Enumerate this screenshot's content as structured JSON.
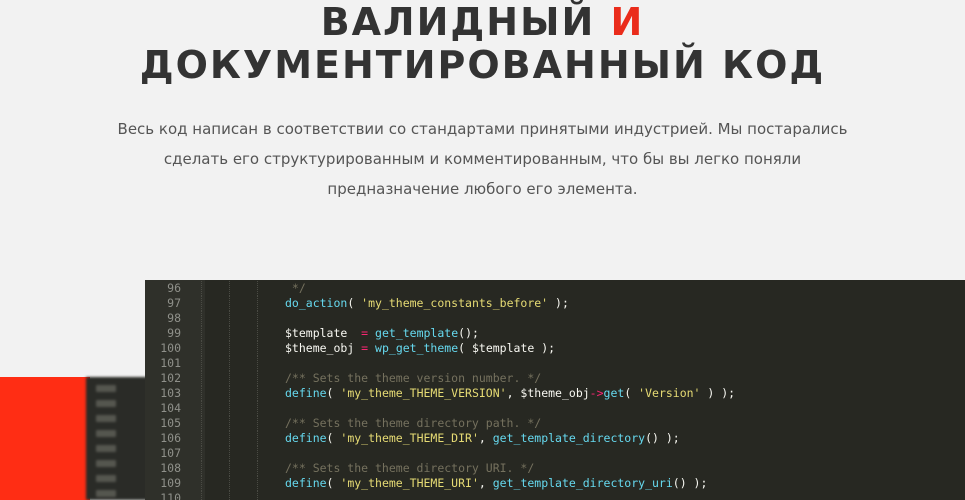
{
  "heading": {
    "line1_main": "ВАЛИДНЫЙ",
    "line1_accent": "И",
    "line2": "ДОКУМЕНТИРОВАННЫЙ КОД"
  },
  "description": {
    "line1": "Весь код написан в соответствии со стандартами принятыми индустрией. Мы постарались",
    "line2": "сделать его структурированным и комментированным, что бы вы легко поняли",
    "line3": "предназначение любого его элемента."
  },
  "colors": {
    "accent": "#ea2c1b",
    "editor_bg": "#272822",
    "red_block": "#ff2d14"
  },
  "code": {
    "lines": [
      {
        "n": "96",
        "tokens": [
          {
            "t": " */",
            "c": "cm"
          }
        ]
      },
      {
        "n": "97",
        "tokens": [
          {
            "t": "do_action",
            "c": "fn"
          },
          {
            "t": "( ",
            "c": ""
          },
          {
            "t": "'my_theme_constants_before'",
            "c": "str"
          },
          {
            "t": " );",
            "c": ""
          }
        ]
      },
      {
        "n": "98",
        "tokens": []
      },
      {
        "n": "99",
        "tokens": [
          {
            "t": "$template  ",
            "c": ""
          },
          {
            "t": "=",
            "c": "op"
          },
          {
            "t": " ",
            "c": ""
          },
          {
            "t": "get_template",
            "c": "fn"
          },
          {
            "t": "();",
            "c": ""
          }
        ]
      },
      {
        "n": "100",
        "tokens": [
          {
            "t": "$theme_obj ",
            "c": ""
          },
          {
            "t": "=",
            "c": "op"
          },
          {
            "t": " ",
            "c": ""
          },
          {
            "t": "wp_get_theme",
            "c": "fn"
          },
          {
            "t": "( $template );",
            "c": ""
          }
        ]
      },
      {
        "n": "101",
        "tokens": []
      },
      {
        "n": "102",
        "tokens": [
          {
            "t": "/** Sets the theme version number. */",
            "c": "cm"
          }
        ]
      },
      {
        "n": "103",
        "tokens": [
          {
            "t": "define",
            "c": "fn"
          },
          {
            "t": "( ",
            "c": ""
          },
          {
            "t": "'my_theme_THEME_VERSION'",
            "c": "str"
          },
          {
            "t": ", $theme_obj",
            "c": ""
          },
          {
            "t": "->",
            "c": "op"
          },
          {
            "t": "get",
            "c": "fn"
          },
          {
            "t": "( ",
            "c": ""
          },
          {
            "t": "'Version'",
            "c": "str"
          },
          {
            "t": " ) );",
            "c": ""
          }
        ]
      },
      {
        "n": "104",
        "tokens": []
      },
      {
        "n": "105",
        "tokens": [
          {
            "t": "/** Sets the theme directory path. */",
            "c": "cm"
          }
        ]
      },
      {
        "n": "106",
        "tokens": [
          {
            "t": "define",
            "c": "fn"
          },
          {
            "t": "( ",
            "c": ""
          },
          {
            "t": "'my_theme_THEME_DIR'",
            "c": "str"
          },
          {
            "t": ", ",
            "c": ""
          },
          {
            "t": "get_template_directory",
            "c": "fn"
          },
          {
            "t": "() );",
            "c": ""
          }
        ]
      },
      {
        "n": "107",
        "tokens": []
      },
      {
        "n": "108",
        "tokens": [
          {
            "t": "/** Sets the theme directory URI. */",
            "c": "cm"
          }
        ]
      },
      {
        "n": "109",
        "tokens": [
          {
            "t": "define",
            "c": "fn"
          },
          {
            "t": "( ",
            "c": ""
          },
          {
            "t": "'my_theme_THEME_URI'",
            "c": "str"
          },
          {
            "t": ", ",
            "c": ""
          },
          {
            "t": "get_template_directory_uri",
            "c": "fn"
          },
          {
            "t": "() );",
            "c": ""
          }
        ]
      },
      {
        "n": "110",
        "tokens": []
      }
    ]
  }
}
